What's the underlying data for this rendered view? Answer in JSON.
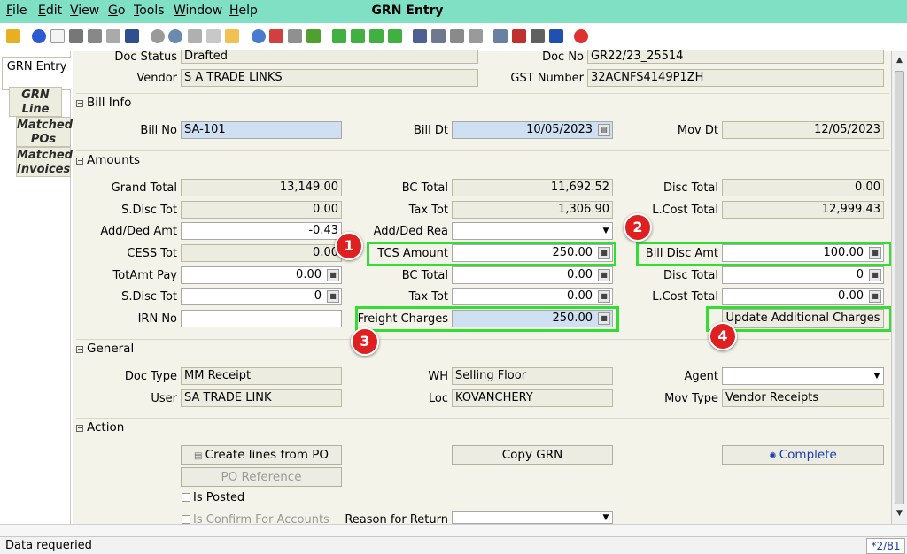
{
  "menubar": {
    "items": [
      "File",
      "Edit",
      "View",
      "Go",
      "Tools",
      "Window",
      "Help"
    ],
    "title": "GRN Entry",
    "color": "#7fe0c4"
  },
  "tabs": [
    "GRN Entry",
    "GRN Line",
    "Matched POs",
    "Matched Invoices"
  ],
  "top": {
    "doc_status_label": "Doc Status",
    "doc_status": "Drafted",
    "doc_no_label": "Doc No",
    "doc_no": "GR22/23_25514",
    "vendor_label": "Vendor",
    "vendor": "S A TRADE LINKS",
    "gst_label": "GST Number",
    "gst": "32ACNFS4149P1ZH"
  },
  "bill_info": {
    "title": "Bill Info",
    "bill_no_label": "Bill No",
    "bill_no": "SA-101",
    "bill_dt_label": "Bill Dt",
    "bill_dt": "10/05/2023",
    "mov_dt_label": "Mov Dt",
    "mov_dt": "12/05/2023"
  },
  "amounts": {
    "title": "Amounts",
    "grand_total_label": "Grand Total",
    "grand_total": "13,149.00",
    "bc_total_label": "BC Total",
    "bc_total": "11,692.52",
    "disc_total_label": "Disc Total",
    "disc_total": "0.00",
    "sdisc_tot_label": "S.Disc Tot",
    "sdisc_tot": "0.00",
    "tax_tot_label": "Tax Tot",
    "tax_tot": "1,306.90",
    "lcost_total_label": "L.Cost Total",
    "lcost_total": "12,999.43",
    "add_ded_amt_label": "Add/Ded Amt",
    "add_ded_amt": "-0.43",
    "add_ded_rea_label": "Add/Ded Rea",
    "add_ded_rea": "",
    "cess_tot_label": "CESS Tot",
    "cess_tot": "0.00",
    "tcs_amount_label": "TCS Amount",
    "tcs_amount": "250.00",
    "bill_disc_amt_label": "Bill Disc Amt",
    "bill_disc_amt": "100.00",
    "totamt_pay_label": "TotAmt Pay",
    "totamt_pay": "0.00",
    "bc_total2_label": "BC Total",
    "bc_total2": "0.00",
    "disc_total2_label": "Disc Total",
    "disc_total2": "0",
    "sdisc_tot2_label": "S.Disc Tot",
    "sdisc_tot2": "0",
    "tax_tot2_label": "Tax Tot",
    "tax_tot2": "0.00",
    "lcost_total2_label": "L.Cost Total",
    "lcost_total2": "0.00",
    "irn_no_label": "IRN No",
    "irn_no": "",
    "freight_label": "Freight Charges",
    "freight": "250.00",
    "update_button": "Update Additional Charges"
  },
  "general": {
    "title": "General",
    "doc_type_label": "Doc Type",
    "doc_type": "MM Receipt",
    "wh_label": "WH",
    "wh": "Selling Floor",
    "agent_label": "Agent",
    "agent": "",
    "user_label": "User",
    "user": "SA TRADE LINK",
    "loc_label": "Loc",
    "loc": "KOVANCHERY",
    "mov_type_label": "Mov Type",
    "mov_type": "Vendor Receipts"
  },
  "action": {
    "title": "Action",
    "create_lines": "Create lines from PO",
    "copy_grn": "Copy GRN",
    "complete": "Complete",
    "po_reference": "PO Reference",
    "is_posted": "Is Posted",
    "is_confirm": "Is Confirm For Accounts",
    "reason_label": "Reason for Return"
  },
  "badges": [
    "1",
    "2",
    "3",
    "4"
  ],
  "status": {
    "message": "Data requeried",
    "page": "*2/81"
  },
  "colors": {
    "highlight": "#33dd33",
    "badge": "#e02020",
    "field_blue": "#cfe0f3"
  }
}
